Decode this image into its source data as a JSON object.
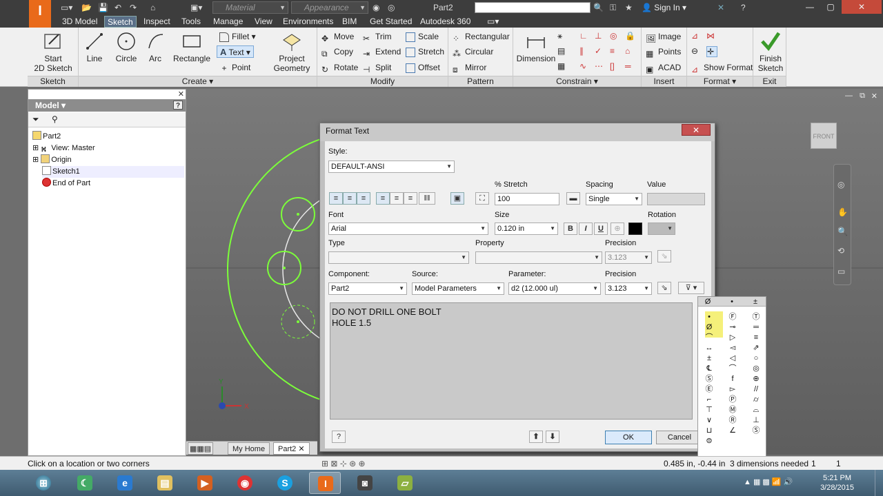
{
  "titlebar": {
    "logo_text": "I",
    "material_placeholder": "Material",
    "appearance_placeholder": "Appearance",
    "doc_title": "Part2",
    "signin": "Sign In",
    "help": "?"
  },
  "tabs": [
    "3D Model",
    "Sketch",
    "Inspect",
    "Tools",
    "Manage",
    "View",
    "Environments",
    "BIM",
    "Get Started",
    "Autodesk 360"
  ],
  "ribbon": {
    "sketch": {
      "start_line1": "Start",
      "start_line2": "2D Sketch",
      "panel": "Sketch"
    },
    "create": {
      "line": "Line",
      "circle": "Circle",
      "arc": "Arc",
      "rectangle": "Rectangle",
      "fillet": "Fillet",
      "text": "Text",
      "point": "Point",
      "project_line1": "Project",
      "project_line2": "Geometry",
      "panel": "Create"
    },
    "modify": {
      "move": "Move",
      "trim": "Trim",
      "scale": "Scale",
      "copy": "Copy",
      "extend": "Extend",
      "stretch": "Stretch",
      "rotate": "Rotate",
      "split": "Split",
      "offset": "Offset",
      "panel": "Modify"
    },
    "pattern": {
      "rectangular": "Rectangular",
      "circular": "Circular",
      "mirror": "Mirror",
      "panel": "Pattern"
    },
    "constrain": {
      "dimension": "Dimension",
      "panel": "Constrain"
    },
    "insert": {
      "image": "Image",
      "points": "Points",
      "acad": "ACAD",
      "panel": "Insert"
    },
    "format": {
      "show_format": "Show Format",
      "panel": "Format"
    },
    "exit": {
      "finish_line1": "Finish",
      "finish_line2": "Sketch",
      "panel": "Exit"
    }
  },
  "browser": {
    "title": "Model",
    "tree": [
      {
        "label": "Part2",
        "icon": "part-icon"
      },
      {
        "label": "View: Master",
        "icon": "view-icon"
      },
      {
        "label": "Origin",
        "icon": "folder-icon"
      },
      {
        "label": "Sketch1",
        "icon": "sketch-icon"
      },
      {
        "label": "End of Part",
        "icon": "end-of-part-icon"
      }
    ]
  },
  "doctabs": {
    "home": "My Home",
    "part": "Part2"
  },
  "dialog": {
    "title": "Format Text",
    "style_label": "Style:",
    "style_value": "DEFAULT-ANSI",
    "stretch_label": "% Stretch",
    "stretch_value": "100",
    "spacing_label": "Spacing",
    "spacing_value": "Single",
    "value_label": "Value",
    "font_label": "Font",
    "font_value": "Arial",
    "size_label": "Size",
    "size_value": "0.120 in",
    "bold": "B",
    "italic": "I",
    "underline": "U",
    "rotation_label": "Rotation",
    "type_label": "Type",
    "property_label": "Property",
    "precision_label": "Precision",
    "precision_value_disabled": "3.123",
    "component_label": "Component:",
    "component_value": "Part2",
    "source_label": "Source:",
    "source_value": "Model Parameters",
    "parameter_label": "Parameter:",
    "parameter_value": "d2 (12.000 ul)",
    "precision2_label": "Precision",
    "precision2_value": "3.123",
    "text_content": "DO NOT DRILL ONE BOLT\nHOLE 1.5",
    "ok": "OK",
    "cancel": "Cancel",
    "help": "?"
  },
  "palette": {
    "header": [
      "Ø",
      "•",
      "±"
    ],
    "symbols": [
      "•",
      "Ⓕ",
      "Ⓣ",
      "Ø",
      "⊸",
      "═",
      "⌒",
      "▷",
      "≡",
      "↔",
      "◅",
      "⇗",
      "±",
      "◁",
      "○",
      "℄",
      "⌒",
      "◎",
      "Ⓢ",
      "f",
      "⊕",
      "Ⓔ",
      "▻",
      "//",
      "⌐",
      "Ⓟ",
      "⌭",
      "⊤",
      "Ⓜ",
      "⌓",
      "∨",
      "Ⓡ",
      "⊥",
      "⊔",
      "∠",
      "Ⓢ",
      "⊜"
    ]
  },
  "status": {
    "message": "Click on a location or two corners",
    "coords": "0.485 in, -0.44 in",
    "dims_needed": "3 dimensions needed",
    "count1": "1",
    "count2": "1"
  },
  "taskbar": {
    "time": "5:21 PM",
    "date": "3/28/2015"
  },
  "colors": {
    "sketch_green": "#7cff3a",
    "accent": "#e96a1a"
  }
}
